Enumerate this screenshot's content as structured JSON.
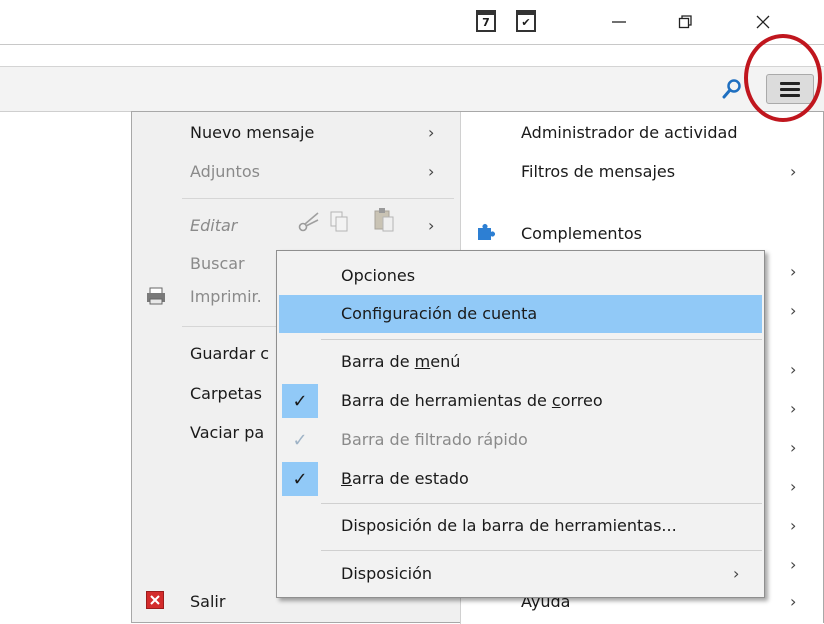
{
  "window": {
    "calendar_day": "7"
  },
  "left_menu": {
    "items": [
      {
        "label": "Nuevo mensaje",
        "enabled": true,
        "submenu": true
      },
      {
        "label": "Adjuntos",
        "enabled": false,
        "submenu": true
      },
      {
        "label": "Editar",
        "enabled": false,
        "submenu": true
      },
      {
        "label": "Buscar",
        "enabled": false
      },
      {
        "label": "Imprimir...",
        "visible_text": "Imprimir.",
        "enabled": false
      },
      {
        "label": "Guardar c",
        "enabled": true
      },
      {
        "label": "Carpetas",
        "enabled": true
      },
      {
        "label": "Vaciar pa",
        "enabled": true
      },
      {
        "label": "Salir",
        "enabled": true
      }
    ]
  },
  "right_menu": {
    "items": [
      {
        "label": "Administrador de actividad"
      },
      {
        "label": "Filtros de mensajes",
        "submenu": true
      },
      {
        "label": "Complementos"
      },
      {
        "label": "Ayuda",
        "submenu": true
      }
    ]
  },
  "submenu": {
    "items": [
      {
        "label": "Opciones",
        "highlighted": false
      },
      {
        "label": "Configuración de cuenta",
        "highlighted": true
      },
      {
        "label_pre": "Barra de ",
        "label_u": "m",
        "label_post": "enú",
        "checked": false
      },
      {
        "label_pre": "Barra de herramientas de ",
        "label_u": "c",
        "label_post": "orreo",
        "checked": true
      },
      {
        "label": "Barra de filtrado rápido",
        "checked": true,
        "enabled": false
      },
      {
        "label_pre": "",
        "label_u": "B",
        "label_post": "arra de estado",
        "checked": true
      },
      {
        "label": "Disposición de la barra de herramientas..."
      },
      {
        "label": "Disposición",
        "submenu": true
      }
    ]
  },
  "colors": {
    "highlight": "#91c9f7",
    "annotation_circle": "#c0161e",
    "exit_icon": "#d32b2b"
  },
  "icons": [
    "calendar-icon",
    "tasks-icon",
    "minimize-icon",
    "restore-icon",
    "close-icon",
    "search-icon",
    "hamburger-menu-icon",
    "scissors-icon",
    "copy-icon",
    "paste-icon",
    "printer-icon",
    "puzzle-icon",
    "exit-icon",
    "checkmark-icon",
    "chevron-right-icon"
  ]
}
